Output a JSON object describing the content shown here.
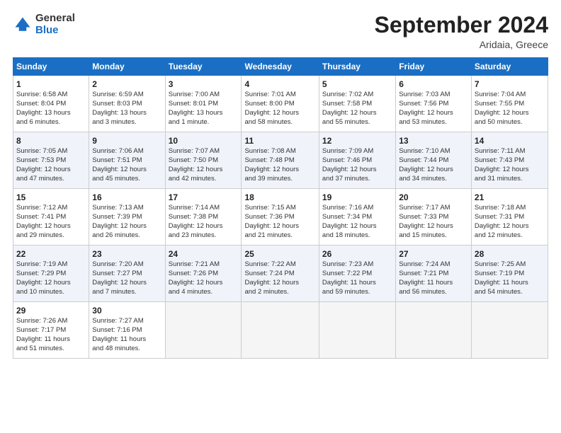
{
  "logo": {
    "general": "General",
    "blue": "Blue"
  },
  "header": {
    "month": "September 2024",
    "location": "Aridaia, Greece"
  },
  "weekdays": [
    "Sunday",
    "Monday",
    "Tuesday",
    "Wednesday",
    "Thursday",
    "Friday",
    "Saturday"
  ],
  "weeks": [
    [
      {
        "day": "1",
        "lines": [
          "Sunrise: 6:58 AM",
          "Sunset: 8:04 PM",
          "Daylight: 13 hours",
          "and 6 minutes."
        ]
      },
      {
        "day": "2",
        "lines": [
          "Sunrise: 6:59 AM",
          "Sunset: 8:03 PM",
          "Daylight: 13 hours",
          "and 3 minutes."
        ]
      },
      {
        "day": "3",
        "lines": [
          "Sunrise: 7:00 AM",
          "Sunset: 8:01 PM",
          "Daylight: 13 hours",
          "and 1 minute."
        ]
      },
      {
        "day": "4",
        "lines": [
          "Sunrise: 7:01 AM",
          "Sunset: 8:00 PM",
          "Daylight: 12 hours",
          "and 58 minutes."
        ]
      },
      {
        "day": "5",
        "lines": [
          "Sunrise: 7:02 AM",
          "Sunset: 7:58 PM",
          "Daylight: 12 hours",
          "and 55 minutes."
        ]
      },
      {
        "day": "6",
        "lines": [
          "Sunrise: 7:03 AM",
          "Sunset: 7:56 PM",
          "Daylight: 12 hours",
          "and 53 minutes."
        ]
      },
      {
        "day": "7",
        "lines": [
          "Sunrise: 7:04 AM",
          "Sunset: 7:55 PM",
          "Daylight: 12 hours",
          "and 50 minutes."
        ]
      }
    ],
    [
      {
        "day": "8",
        "lines": [
          "Sunrise: 7:05 AM",
          "Sunset: 7:53 PM",
          "Daylight: 12 hours",
          "and 47 minutes."
        ]
      },
      {
        "day": "9",
        "lines": [
          "Sunrise: 7:06 AM",
          "Sunset: 7:51 PM",
          "Daylight: 12 hours",
          "and 45 minutes."
        ]
      },
      {
        "day": "10",
        "lines": [
          "Sunrise: 7:07 AM",
          "Sunset: 7:50 PM",
          "Daylight: 12 hours",
          "and 42 minutes."
        ]
      },
      {
        "day": "11",
        "lines": [
          "Sunrise: 7:08 AM",
          "Sunset: 7:48 PM",
          "Daylight: 12 hours",
          "and 39 minutes."
        ]
      },
      {
        "day": "12",
        "lines": [
          "Sunrise: 7:09 AM",
          "Sunset: 7:46 PM",
          "Daylight: 12 hours",
          "and 37 minutes."
        ]
      },
      {
        "day": "13",
        "lines": [
          "Sunrise: 7:10 AM",
          "Sunset: 7:44 PM",
          "Daylight: 12 hours",
          "and 34 minutes."
        ]
      },
      {
        "day": "14",
        "lines": [
          "Sunrise: 7:11 AM",
          "Sunset: 7:43 PM",
          "Daylight: 12 hours",
          "and 31 minutes."
        ]
      }
    ],
    [
      {
        "day": "15",
        "lines": [
          "Sunrise: 7:12 AM",
          "Sunset: 7:41 PM",
          "Daylight: 12 hours",
          "and 29 minutes."
        ]
      },
      {
        "day": "16",
        "lines": [
          "Sunrise: 7:13 AM",
          "Sunset: 7:39 PM",
          "Daylight: 12 hours",
          "and 26 minutes."
        ]
      },
      {
        "day": "17",
        "lines": [
          "Sunrise: 7:14 AM",
          "Sunset: 7:38 PM",
          "Daylight: 12 hours",
          "and 23 minutes."
        ]
      },
      {
        "day": "18",
        "lines": [
          "Sunrise: 7:15 AM",
          "Sunset: 7:36 PM",
          "Daylight: 12 hours",
          "and 21 minutes."
        ]
      },
      {
        "day": "19",
        "lines": [
          "Sunrise: 7:16 AM",
          "Sunset: 7:34 PM",
          "Daylight: 12 hours",
          "and 18 minutes."
        ]
      },
      {
        "day": "20",
        "lines": [
          "Sunrise: 7:17 AM",
          "Sunset: 7:33 PM",
          "Daylight: 12 hours",
          "and 15 minutes."
        ]
      },
      {
        "day": "21",
        "lines": [
          "Sunrise: 7:18 AM",
          "Sunset: 7:31 PM",
          "Daylight: 12 hours",
          "and 12 minutes."
        ]
      }
    ],
    [
      {
        "day": "22",
        "lines": [
          "Sunrise: 7:19 AM",
          "Sunset: 7:29 PM",
          "Daylight: 12 hours",
          "and 10 minutes."
        ]
      },
      {
        "day": "23",
        "lines": [
          "Sunrise: 7:20 AM",
          "Sunset: 7:27 PM",
          "Daylight: 12 hours",
          "and 7 minutes."
        ]
      },
      {
        "day": "24",
        "lines": [
          "Sunrise: 7:21 AM",
          "Sunset: 7:26 PM",
          "Daylight: 12 hours",
          "and 4 minutes."
        ]
      },
      {
        "day": "25",
        "lines": [
          "Sunrise: 7:22 AM",
          "Sunset: 7:24 PM",
          "Daylight: 12 hours",
          "and 2 minutes."
        ]
      },
      {
        "day": "26",
        "lines": [
          "Sunrise: 7:23 AM",
          "Sunset: 7:22 PM",
          "Daylight: 11 hours",
          "and 59 minutes."
        ]
      },
      {
        "day": "27",
        "lines": [
          "Sunrise: 7:24 AM",
          "Sunset: 7:21 PM",
          "Daylight: 11 hours",
          "and 56 minutes."
        ]
      },
      {
        "day": "28",
        "lines": [
          "Sunrise: 7:25 AM",
          "Sunset: 7:19 PM",
          "Daylight: 11 hours",
          "and 54 minutes."
        ]
      }
    ],
    [
      {
        "day": "29",
        "lines": [
          "Sunrise: 7:26 AM",
          "Sunset: 7:17 PM",
          "Daylight: 11 hours",
          "and 51 minutes."
        ]
      },
      {
        "day": "30",
        "lines": [
          "Sunrise: 7:27 AM",
          "Sunset: 7:16 PM",
          "Daylight: 11 hours",
          "and 48 minutes."
        ]
      },
      {
        "day": "",
        "lines": []
      },
      {
        "day": "",
        "lines": []
      },
      {
        "day": "",
        "lines": []
      },
      {
        "day": "",
        "lines": []
      },
      {
        "day": "",
        "lines": []
      }
    ]
  ]
}
